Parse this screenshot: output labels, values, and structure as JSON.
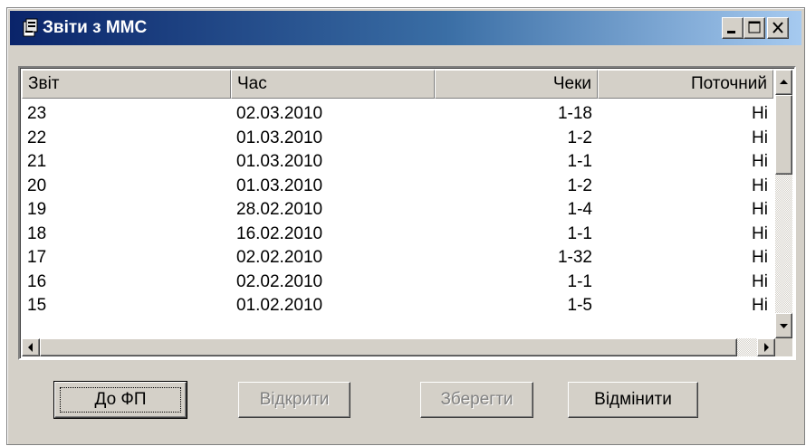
{
  "window": {
    "title": "Звіти з ММС"
  },
  "table": {
    "columns": [
      "Звіт",
      "Час",
      "Чеки",
      "Поточний"
    ],
    "rows": [
      [
        "23",
        "02.03.2010",
        "1-18",
        "Ні"
      ],
      [
        "22",
        "01.03.2010",
        "1-2",
        "Ні"
      ],
      [
        "21",
        "01.03.2010",
        "1-1",
        "Ні"
      ],
      [
        "20",
        "01.03.2010",
        "1-2",
        "Ні"
      ],
      [
        "19",
        "28.02.2010",
        "1-4",
        "Ні"
      ],
      [
        "18",
        "16.02.2010",
        "1-1",
        "Ні"
      ],
      [
        "17",
        "02.02.2010",
        "1-32",
        "Ні"
      ],
      [
        "16",
        "02.02.2010",
        "1-1",
        "Ні"
      ],
      [
        "15",
        "01.02.2010",
        "1-5",
        "Ні"
      ]
    ]
  },
  "buttons": {
    "to_fp": "До ФП",
    "open": "Відкрити",
    "save": "Зберегти",
    "cancel": "Відмінити"
  },
  "icons": {
    "title": "app-document-icon",
    "minimize": "minimize-icon",
    "maximize": "maximize-icon",
    "close": "close-icon",
    "scroll_up": "arrow-up-icon",
    "scroll_down": "arrow-down-icon",
    "scroll_left": "arrow-left-icon",
    "scroll_right": "arrow-right-icon"
  },
  "colors": {
    "titlebar_start": "#0a246a",
    "titlebar_end": "#a6caf0",
    "face": "#d4d0c8"
  }
}
